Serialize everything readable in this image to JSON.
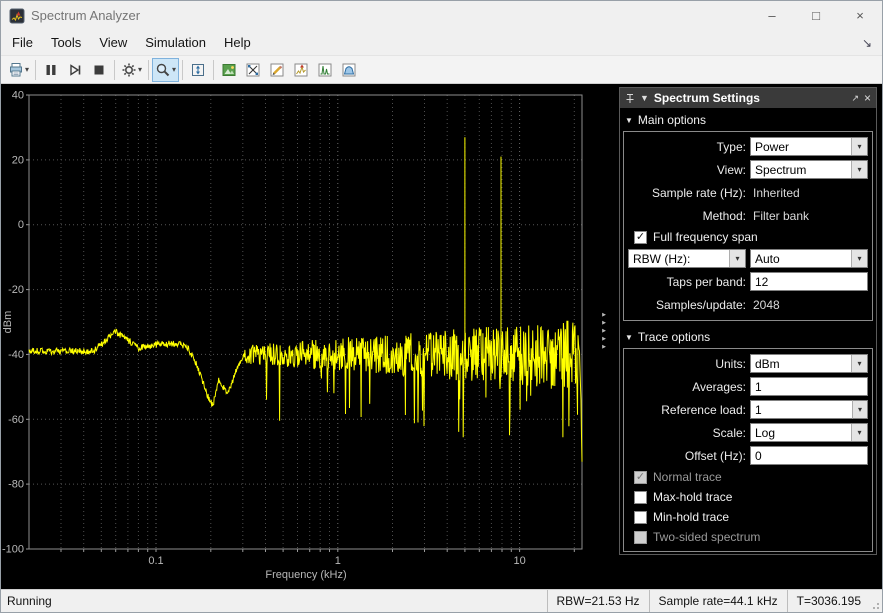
{
  "glyphs": {
    "chevron_down": "▾",
    "check": "✓",
    "section_collapse": "▼",
    "panel_collapse_arrow": "▶",
    "undock": "↗",
    "close": "×",
    "dock": "↘"
  },
  "window": {
    "title": "Spectrum Analyzer",
    "minimize": "–",
    "maximize": "□",
    "close": "×"
  },
  "menubar": {
    "items": [
      "File",
      "Tools",
      "View",
      "Simulation",
      "Help"
    ]
  },
  "toolbar": {
    "buttons": [
      "print",
      "pause",
      "step-forward",
      "stop",
      "playback-settings",
      "zoom",
      "fit-to-view",
      "snapshot",
      "data-cursors",
      "spectral-mask",
      "peak-finder",
      "distortion-measurements",
      "channel-measurements"
    ]
  },
  "settings": {
    "title": "Spectrum Settings",
    "main_options": {
      "label": "Main options",
      "type_label": "Type:",
      "type_value": "Power",
      "view_label": "View:",
      "view_value": "Spectrum",
      "sample_rate_label": "Sample rate (Hz):",
      "sample_rate_value": "Inherited",
      "method_label": "Method:",
      "method_value": "Filter bank",
      "full_span_label": "Full frequency span",
      "rbw_selector_value": "RBW (Hz):",
      "rbw_value": "Auto",
      "taps_label": "Taps per band:",
      "taps_value": "12",
      "samples_label": "Samples/update:",
      "samples_value": "2048"
    },
    "trace_options": {
      "label": "Trace options",
      "units_label": "Units:",
      "units_value": "dBm",
      "averages_label": "Averages:",
      "averages_value": "1",
      "reference_load_label": "Reference load:",
      "reference_load_value": "1",
      "scale_label": "Scale:",
      "scale_value": "Log",
      "offset_label": "Offset (Hz):",
      "offset_value": "0",
      "normal_trace_label": "Normal trace",
      "max_hold_label": "Max-hold trace",
      "min_hold_label": "Min-hold trace",
      "two_sided_label": "Two-sided spectrum"
    }
  },
  "chart_data": {
    "type": "line",
    "title": "Power spectrum trace",
    "xlabel": "Frequency (kHz)",
    "ylabel": "dBm",
    "x_scale": "log",
    "xlim_khz": [
      0.02,
      22.05
    ],
    "ylim": [
      -100,
      40
    ],
    "y_ticks": [
      40,
      20,
      0,
      -20,
      -40,
      -60,
      -80,
      -100
    ],
    "x_tick_labels": [
      "0.1",
      "1",
      "10"
    ],
    "grid": "dotted",
    "legend": "off",
    "trace_color": "#ffff00",
    "plot_background": "#000000",
    "noise_floor_dbm": -40,
    "noise_spread_dbm": [
      2,
      11
    ],
    "low_freq_profile_khz_dbm": [
      [
        0.02,
        -39
      ],
      [
        0.045,
        -39
      ],
      [
        0.06,
        -33
      ],
      [
        0.08,
        -38
      ],
      [
        0.1,
        -37
      ],
      [
        0.13,
        -36.5
      ],
      [
        0.15,
        -38
      ],
      [
        0.17,
        -44
      ],
      [
        0.19,
        -52
      ],
      [
        0.205,
        -56
      ],
      [
        0.22,
        -48
      ],
      [
        0.25,
        -52
      ],
      [
        0.28,
        -44
      ],
      [
        0.3,
        -41
      ]
    ],
    "spikes_khz_dbm": [
      [
        5.0,
        27
      ],
      [
        7.9,
        21
      ]
    ],
    "highband_rolloff_start_khz": 21
  },
  "statusbar": {
    "state": "Running",
    "rbw": "RBW=21.53 Hz",
    "sample_rate": "Sample rate=44.1 kHz",
    "time": "T=3036.195"
  }
}
